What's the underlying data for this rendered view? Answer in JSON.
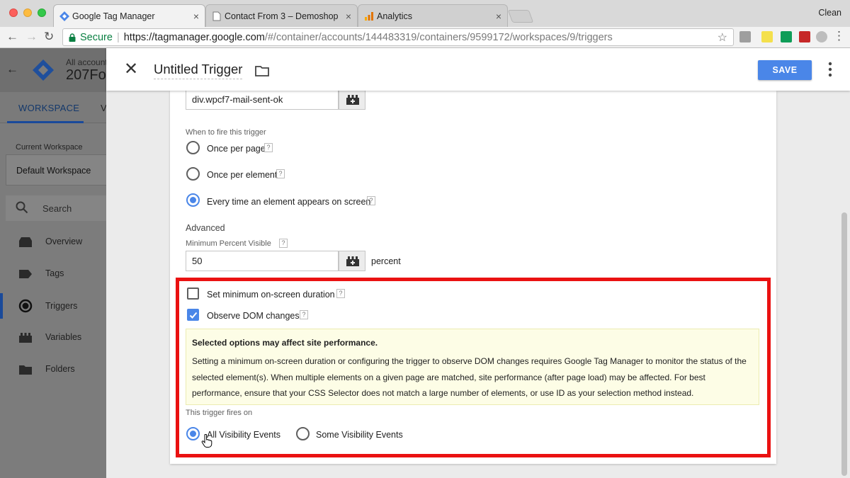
{
  "browser": {
    "tabs": [
      {
        "label": "Google Tag Manager",
        "icon": "gtm-favicon",
        "active": true
      },
      {
        "label": "Contact From 3 – Demoshop",
        "icon": "page-favicon",
        "active": false
      },
      {
        "label": "Analytics",
        "icon": "analytics-favicon",
        "active": false
      }
    ],
    "profile": "Clean",
    "secure_label": "Secure",
    "url_host": "https://tagmanager.google.com",
    "url_path": "/#/container/accounts/144483319/containers/9599172/workspaces/9/triggers"
  },
  "app": {
    "account_label": "All accounts",
    "account_name": "207Fo",
    "tabs": [
      "WORKSPACE",
      "V"
    ],
    "current_workspace_label": "Current Workspace",
    "current_workspace": "Default Workspace",
    "search_label": "Search",
    "nav": [
      {
        "label": "Overview",
        "icon": "overview-icon"
      },
      {
        "label": "Tags",
        "icon": "tag-icon"
      },
      {
        "label": "Triggers",
        "icon": "trigger-icon",
        "active": true
      },
      {
        "label": "Variables",
        "icon": "variable-icon"
      },
      {
        "label": "Folders",
        "icon": "folder-icon"
      }
    ]
  },
  "panel": {
    "title": "Untitled Trigger",
    "save_label": "SAVE"
  },
  "form": {
    "selector_value": "div.wpcf7-mail-sent-ok",
    "fire_label": "When to fire this trigger",
    "fire_options": [
      {
        "label": "Once per page",
        "checked": false
      },
      {
        "label": "Once per element",
        "checked": false
      },
      {
        "label": "Every time an element appears on screen",
        "checked": true
      }
    ],
    "advanced_label": "Advanced",
    "min_percent_label": "Minimum Percent Visible",
    "min_percent_value": "50",
    "percent_unit": "percent",
    "min_duration_label": "Set minimum on-screen duration",
    "min_duration_checked": false,
    "observe_dom_label": "Observe DOM changes",
    "observe_dom_checked": true,
    "warning_title": "Selected options may affect site performance.",
    "warning_body": "Setting a minimum on-screen duration or configuring the trigger to observe DOM changes requires Google Tag Manager to monitor the status of the selected element(s). When multiple elements on a given page are matched, site performance (after page load) may be affected. For best performance, ensure that your CSS Selector does not match a large number of elements, or use ID as your selection method instead.",
    "fires_on_label": "This trigger fires on",
    "fires_on_options": [
      {
        "label": "All Visibility Events",
        "checked": true
      },
      {
        "label": "Some Visibility Events",
        "checked": false
      }
    ],
    "help_glyph": "?"
  },
  "colors": {
    "accent": "#4a86e8",
    "highlight": "#ea1111",
    "warning_bg": "#fdfde6"
  }
}
